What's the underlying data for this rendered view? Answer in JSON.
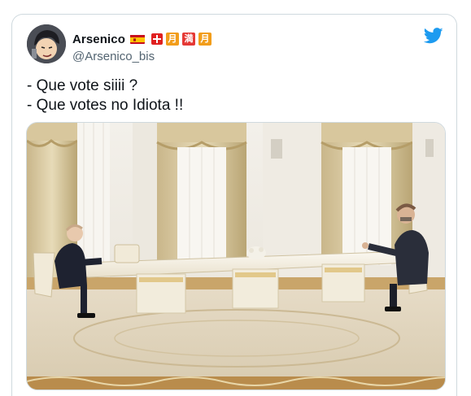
{
  "tweet": {
    "display_name": "Arsenico",
    "handle": "@Arsenico_bis",
    "name_badges": [
      "spain-flag",
      "switzerland-flag",
      "月",
      "満",
      "月"
    ],
    "text_lines": [
      "- Que vote siiii ?",
      "- Que votes no Idiota !!"
    ],
    "icons": {
      "logo": "twitter-bird-icon"
    },
    "colors": {
      "twitter_blue": "#1d9bf0",
      "text": "#0f1419",
      "secondary": "#536471",
      "border": "#cfd9de"
    }
  }
}
